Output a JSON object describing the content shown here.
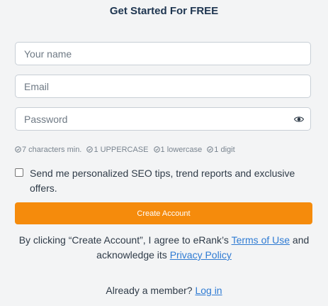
{
  "title": "Get Started For FREE",
  "fields": {
    "name_placeholder": "Your name",
    "email_placeholder": "Email",
    "password_placeholder": "Password",
    "name_value": "",
    "email_value": "",
    "password_value": ""
  },
  "password_requirements": [
    "7 characters min.",
    "1 UPPERCASE",
    "1 lowercase",
    "1 digit"
  ],
  "newsletter": {
    "label": "Send me personalized SEO tips, trend reports and exclusive offers.",
    "checked": false
  },
  "create_button_label": "Create Account",
  "legal": {
    "prefix": "By clicking “Create Account”, I agree to eRank’s ",
    "terms_link": "Terms of Use",
    "middle": " and acknowledge its ",
    "privacy_link": "Privacy Policy"
  },
  "member": {
    "prefix": "Already a member? ",
    "login_link": "Log in"
  },
  "icons": {
    "password_toggle": "eye-icon",
    "requirement": "check-circle-icon"
  },
  "colors": {
    "accent": "#f58b0c",
    "link": "#2f7bd3",
    "title": "#1e3550",
    "background": "#f3f4f5"
  }
}
